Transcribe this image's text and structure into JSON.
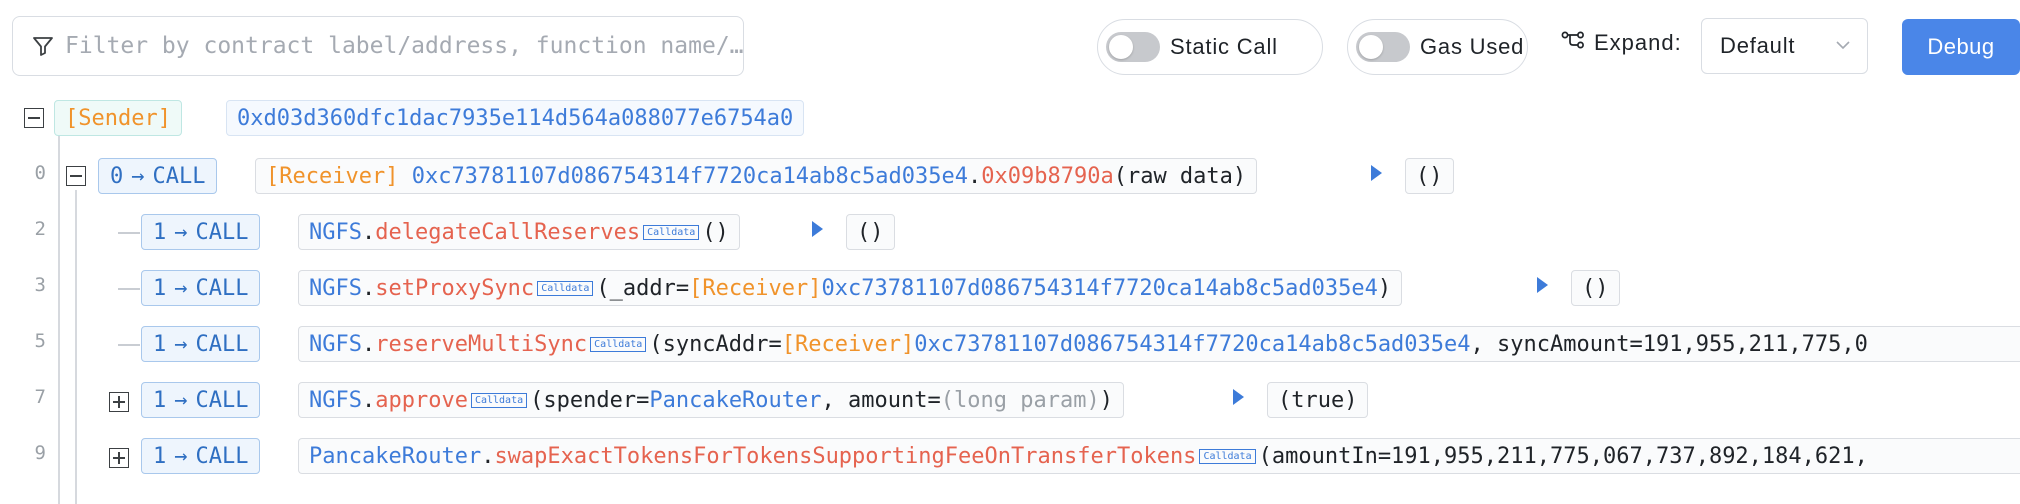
{
  "toolbar": {
    "filter_placeholder": "Filter by contract label/address, function name/…",
    "static_call_label": "Static Call",
    "gas_used_label": "Gas Used",
    "expand_label": "Expand:",
    "expand_value": "Default",
    "debug_label": "Debug",
    "static_call_on": false,
    "gas_used_on": false
  },
  "colors": {
    "accent": "#4a86e8",
    "label_orange": "#f0932b",
    "address_blue": "#3d7bd9",
    "function_red": "#e5634f"
  },
  "sender": {
    "label": "[Sender]",
    "address": "0xd03d360dfc1dac7935e114d564a088077e6754a0"
  },
  "rows": [
    {
      "line": "0",
      "depth": "0",
      "arrow": "→",
      "call_type": "CALL",
      "receiver_label": "[Receiver]",
      "address": "0xc73781107d086754314f7720ca14ab8c5ad035e4",
      "dot": ".",
      "selector": "0x09b8790a",
      "args": "(raw data)",
      "result": "()"
    },
    {
      "line": "2",
      "depth": "1",
      "arrow": "→",
      "call_type": "CALL",
      "contract": "NGFS",
      "dot": ".",
      "func": "delegateCallReserves",
      "calldata": "Calldata",
      "args": "()",
      "result": "()"
    },
    {
      "line": "3",
      "depth": "1",
      "arrow": "→",
      "call_type": "CALL",
      "contract": "NGFS",
      "dot": ".",
      "func": "setProxySync",
      "calldata": "Calldata",
      "args_open": "(_addr=",
      "arg_label": "[Receiver]",
      "arg_address": "0xc73781107d086754314f7720ca14ab8c5ad035e4",
      "args_close": ")",
      "result": "()"
    },
    {
      "line": "5",
      "depth": "1",
      "arrow": "→",
      "call_type": "CALL",
      "contract": "NGFS",
      "dot": ".",
      "func": "reserveMultiSync",
      "calldata": "Calldata",
      "args_open": "(syncAddr=",
      "arg_label": "[Receiver]",
      "arg_address": "0xc73781107d086754314f7720ca14ab8c5ad035e4",
      "args_rest": ", syncAmount=191,955,211,775,0"
    },
    {
      "line": "7",
      "depth": "1",
      "arrow": "→",
      "call_type": "CALL",
      "contract": "NGFS",
      "dot": ".",
      "func": "approve",
      "calldata": "Calldata",
      "args_open": "(spender=",
      "arg_contract": "PancakeRouter",
      "args_mid": ", amount=",
      "arg_long": "(long param)",
      "args_close": ")",
      "result": "(true)"
    },
    {
      "line": "9",
      "depth": "1",
      "arrow": "→",
      "call_type": "CALL",
      "contract": "PancakeRouter",
      "dot": ".",
      "func": "swapExactTokensForTokensSupportingFeeOnTransferTokens",
      "calldata": "Calldata",
      "args_open": "(amountIn=191,955,211,775,067,737,892,184,621,"
    }
  ]
}
